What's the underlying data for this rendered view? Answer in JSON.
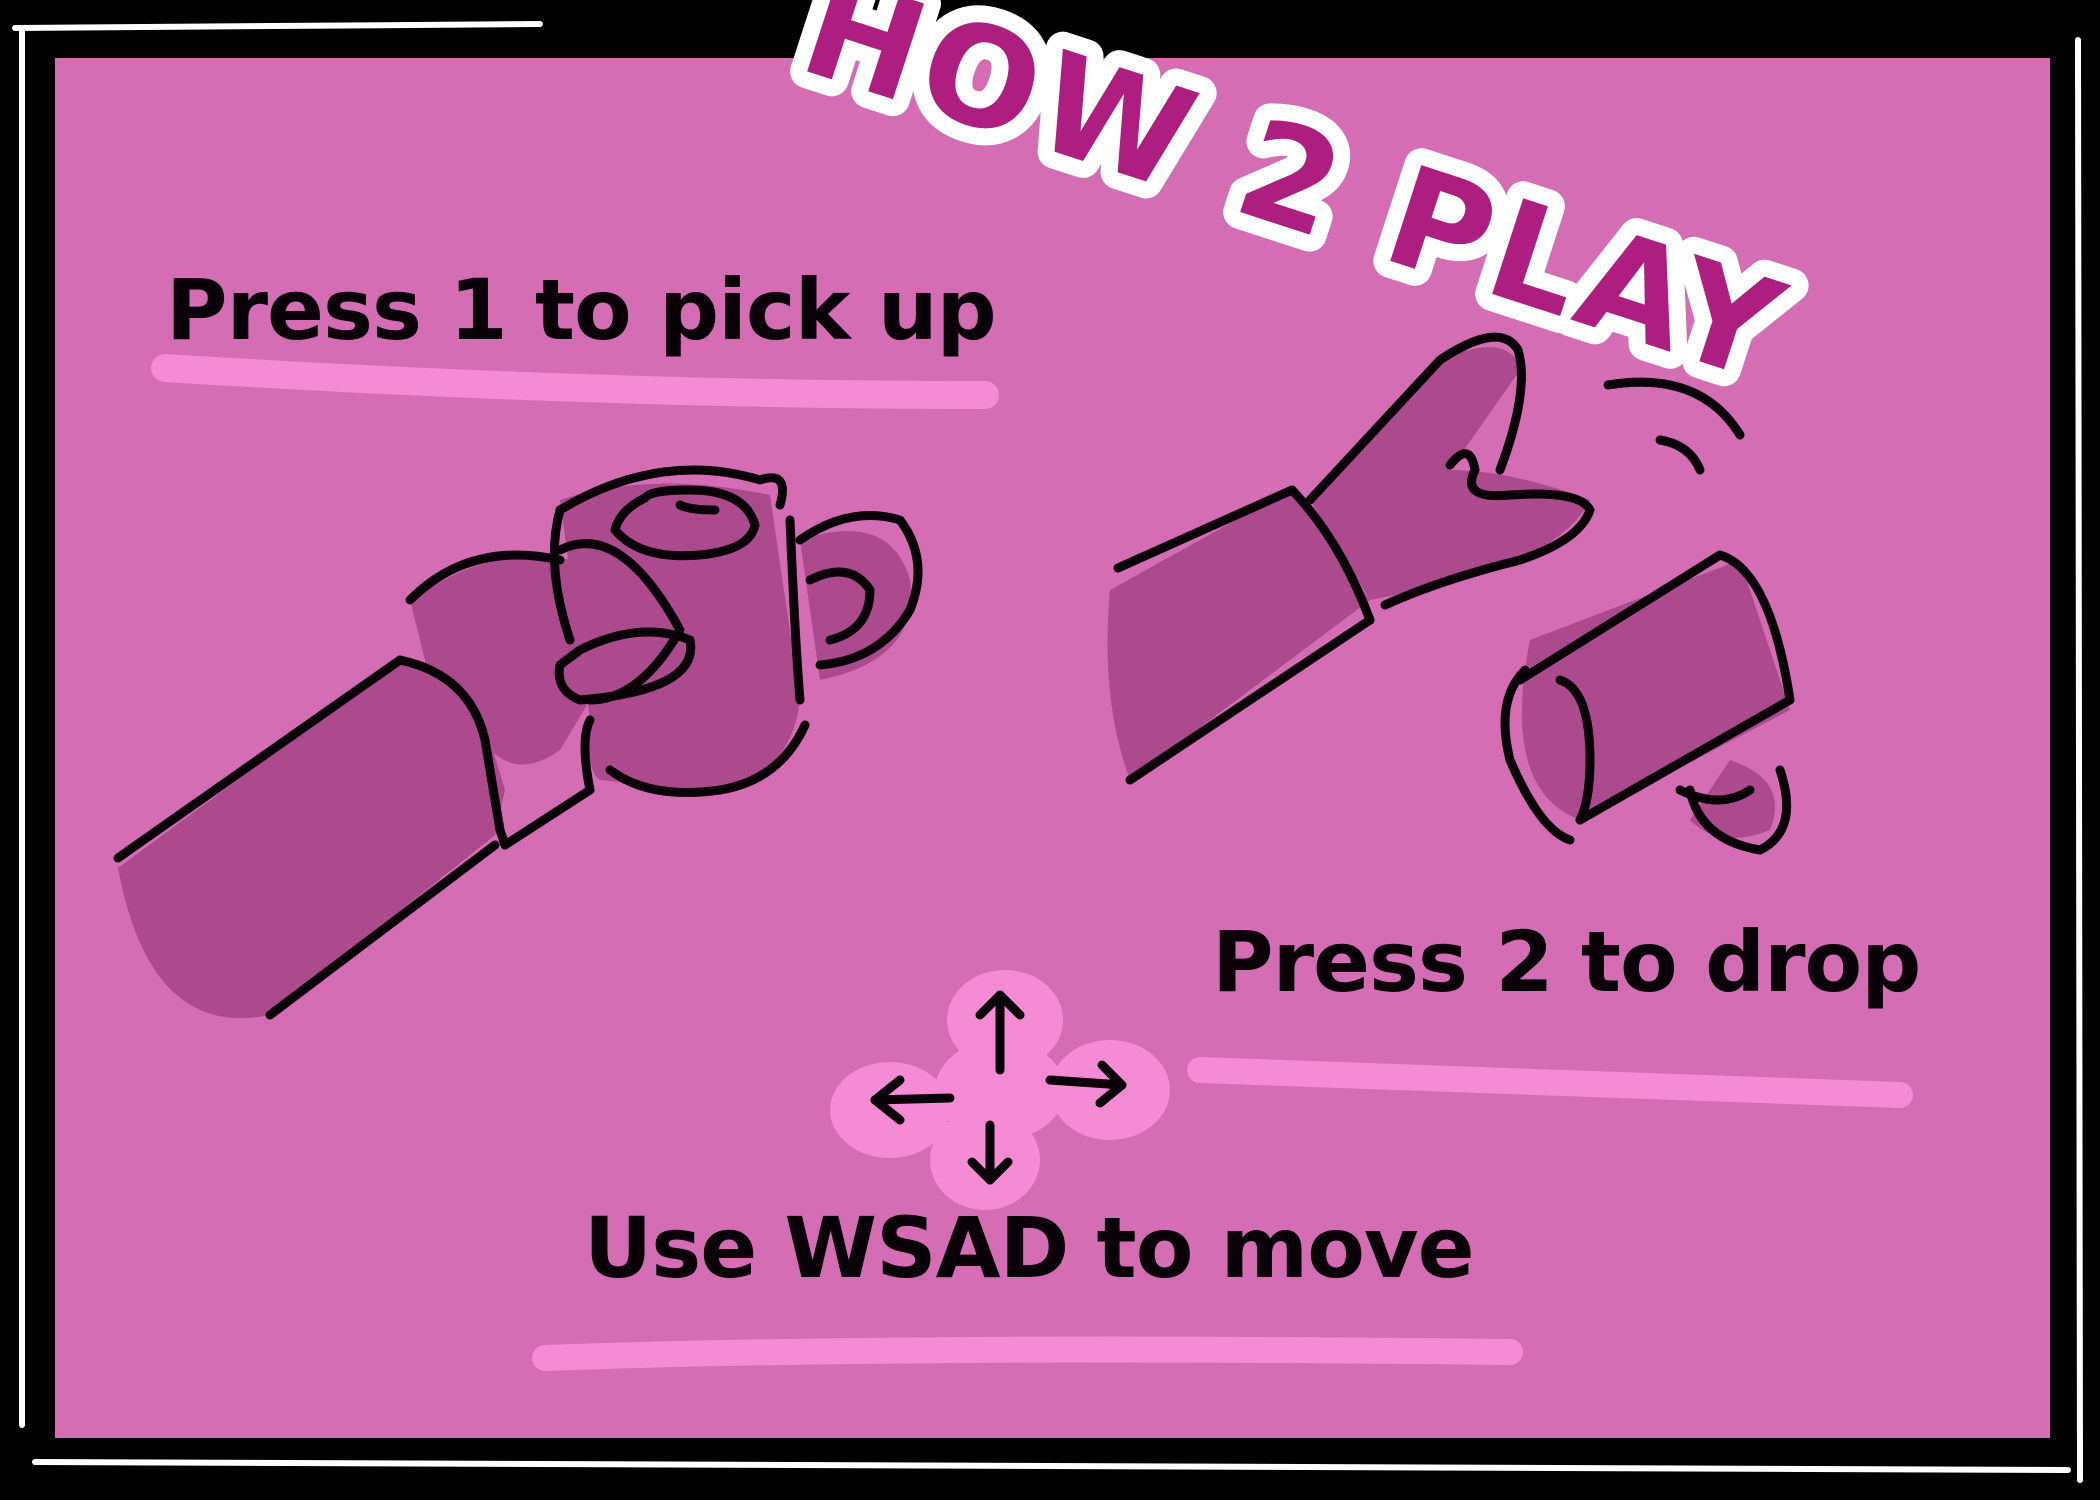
{
  "screen": {
    "title": "HOW 2 PLAY",
    "instructions": {
      "pickup": "Press 1 to pick up",
      "drop": "Press 2 to drop",
      "move": "Use WSAD to move"
    }
  },
  "colors": {
    "background": "#d46db4",
    "fill": "#ad4a8d",
    "highlight": "#f48bd4",
    "ink": "#0a0008",
    "title_fill": "#ad1e80",
    "title_outline": "#ffffff"
  },
  "icons": [
    "hand-holding-mug-icon",
    "hand-dropping-mug-icon",
    "arrow-keys-icon"
  ]
}
